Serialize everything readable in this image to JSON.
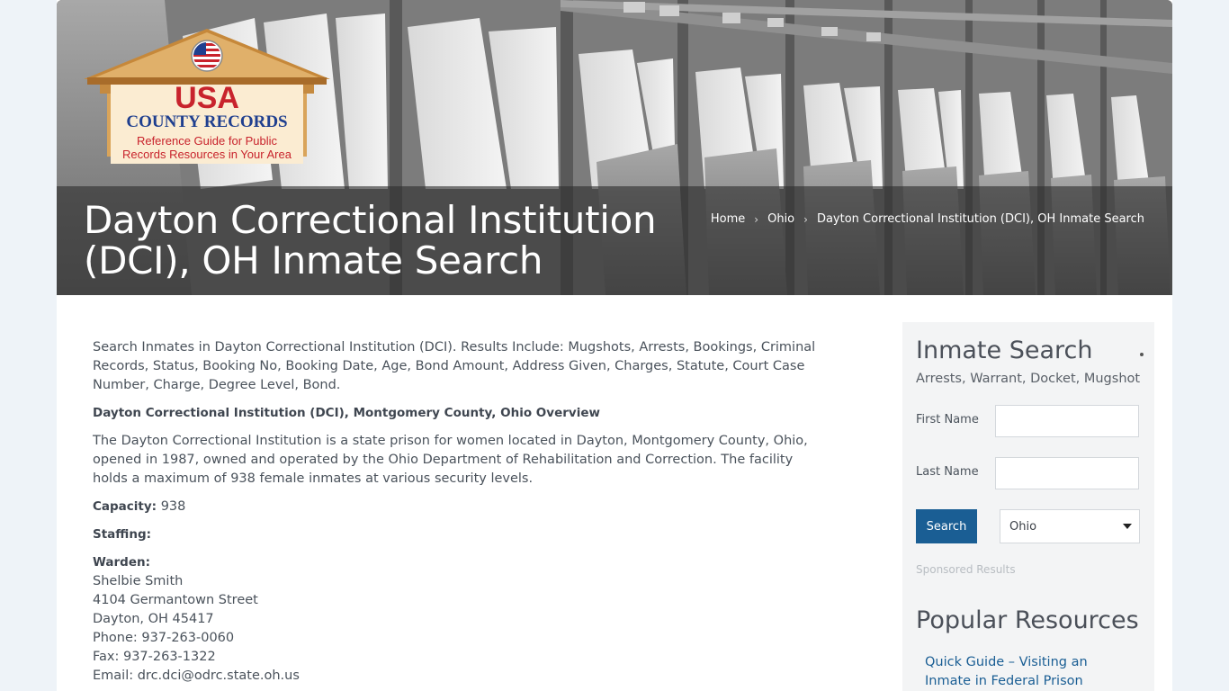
{
  "logo": {
    "brand_line1": "USA",
    "brand_line2": "COUNTY RECORDS",
    "tagline_line1": "Reference Guide for Public",
    "tagline_line2": "Records Resources in Your Area"
  },
  "header": {
    "title": "Dayton Correctional Institution (DCI), OH Inmate Search",
    "breadcrumb": [
      "Home",
      "Ohio",
      "Dayton Correctional Institution (DCI), OH Inmate Search"
    ]
  },
  "main": {
    "intro": "Search Inmates in Dayton Correctional Institution (DCI). Results Include: Mugshots, Arrests, Bookings, Criminal Records, Status, Booking No, Booking Date, Age, Bond Amount, Address Given, Charges, Statute, Court Case Number, Charge, Degree Level, Bond.",
    "overview_heading": "Dayton Correctional Institution (DCI), Montgomery County, Ohio Overview",
    "overview_text": "The Dayton Correctional Institution is a state prison for women located in Dayton, Montgomery County, Ohio, opened in 1987, owned and operated by the Ohio Department of Rehabilitation and Correction. The facility holds a maximum of 938 female inmates at various security levels.",
    "capacity_label": "Capacity:",
    "capacity_value": "938",
    "staffing_label": "Staffing:",
    "warden_label": "Warden:",
    "warden_name": "Shelbie Smith",
    "address_street": "4104 Germantown Street",
    "address_city": "Dayton, OH 45417",
    "phone": "Phone: 937-263-0060",
    "fax": "Fax: 937-263-1322",
    "email": "Email: drc.dci@odrc.state.oh.us"
  },
  "sidebar": {
    "title": "Inmate Search",
    "subtitle": "Arrests, Warrant, Docket, Mugshot",
    "first_name_label": "First Name",
    "last_name_label": "Last Name",
    "first_name_value": "",
    "last_name_value": "",
    "search_button": "Search",
    "state_selected": "Ohio",
    "sponsored": "Sponsored Results",
    "popular_title": "Popular Resources",
    "popular_link": "Quick Guide – Visiting an Inmate in Federal Prison"
  },
  "colors": {
    "accent": "#1a5e94",
    "logo_red": "#c8232c",
    "logo_blue": "#1f3f8f",
    "logo_gold": "#d4a24c"
  }
}
